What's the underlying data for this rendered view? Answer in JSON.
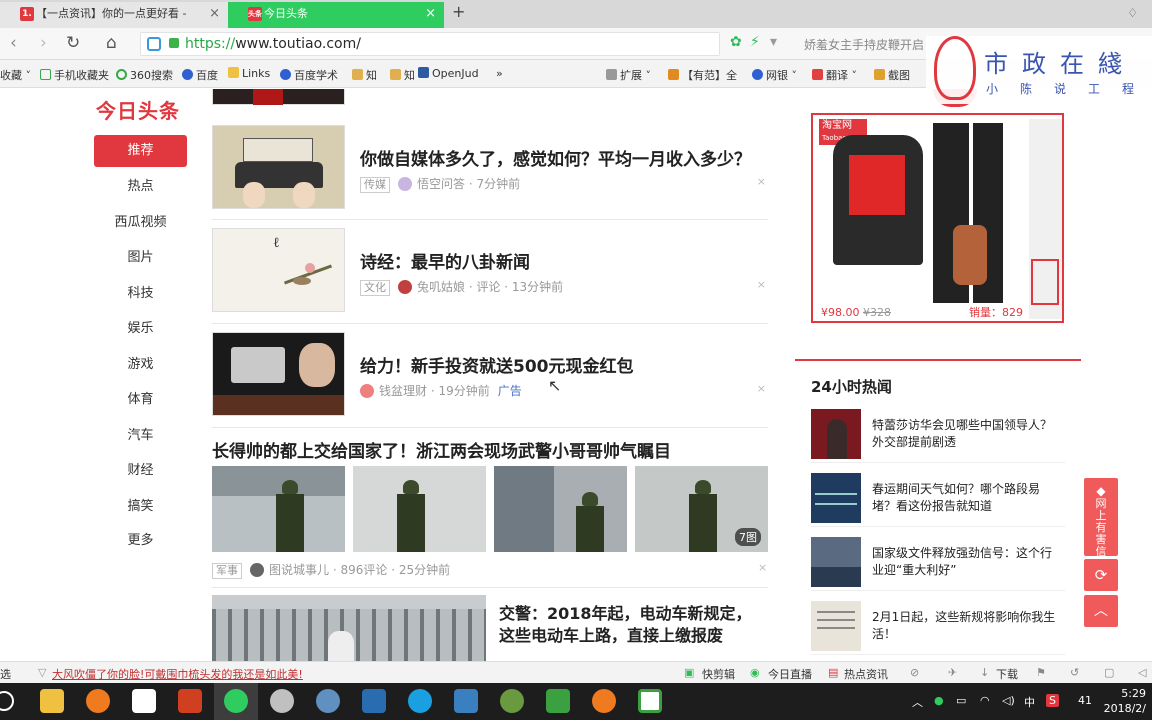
{
  "browser": {
    "tabs": [
      {
        "label": "【一点资讯】你的一点更好看 -",
        "favicon": "1."
      },
      {
        "label": "今日头条",
        "favicon": "头条"
      }
    ],
    "new_tab": "+",
    "url_scheme": "https://",
    "url_rest": "www.toutiao.com/",
    "nav_right_text": "娇羞女主手持皮鞭开启",
    "bookmarks": [
      "收藏",
      "手机收藏夹",
      "360搜索",
      "百度",
      "Links",
      "百度学术",
      "知",
      "知",
      "OpenJud",
      "»",
      "扩展",
      "【有范】全",
      "网银",
      "翻译",
      "截图"
    ]
  },
  "site": {
    "logo": "今日头条",
    "nav": [
      "推荐",
      "热点",
      "西瓜视频",
      "图片",
      "科技",
      "娱乐",
      "游戏",
      "体育",
      "汽车",
      "财经",
      "搞笑",
      "更多"
    ]
  },
  "feed": [
    {
      "title": "你做自媒体多久了，感觉如何？平均一月收入多少？",
      "tag": "传媒",
      "source": "悟空问答",
      "time": "7分钟前",
      "close": "×"
    },
    {
      "title": "诗经：最早的八卦新闻",
      "tag": "文化",
      "source": "兔叽姑娘 · 评论",
      "time": "13分钟前",
      "close": "×"
    },
    {
      "title": "给力！新手投资就送500元现金红包",
      "source": "钱盆理财",
      "time": "19分钟前",
      "ad": "广告",
      "close": "×"
    }
  ],
  "gallery": {
    "title": "长得帅的都上交给国家了！浙江两会现场武警小哥哥帅气瞩目",
    "count": "7图",
    "tag": "军事",
    "source": "图说城事儿",
    "comments": "896评论",
    "time": "25分钟前",
    "close": "×"
  },
  "last_item": {
    "title": "交警：2018年起，电动车新规定，这些电动车上路，直接上缴报废"
  },
  "ad_box": {
    "brand": "淘宝网",
    "brand_sub": "Taobao.com",
    "price": "¥98.00",
    "old_price": "¥328",
    "sales": "销量：829"
  },
  "hot": {
    "title": "24小时热闻",
    "items": [
      "特蕾莎访华会见哪些中国领导人？外交部提前剧透",
      "春运期间天气如何？哪个路段易堵？看这份报告就知道",
      "国家级文件释放强劲信号：这个行业迎“重大利好”",
      "2月1日起，这些新规将影响你我生活！"
    ]
  },
  "side_buttons": {
    "report": "网上有害信息举报"
  },
  "watermark": {
    "big": "市政在綫",
    "small": "小陈说工程"
  },
  "status": {
    "left_prefix": "选",
    "news": "大风吹僵了你的脸!可戴围巾梳头发的我还是如此美!",
    "right": [
      "快剪辑",
      "今日直播",
      "热点资讯",
      "下载"
    ]
  },
  "taskbar": {
    "time": "5:29",
    "date": "2018/2/",
    "ime": "中",
    "num": "41"
  }
}
